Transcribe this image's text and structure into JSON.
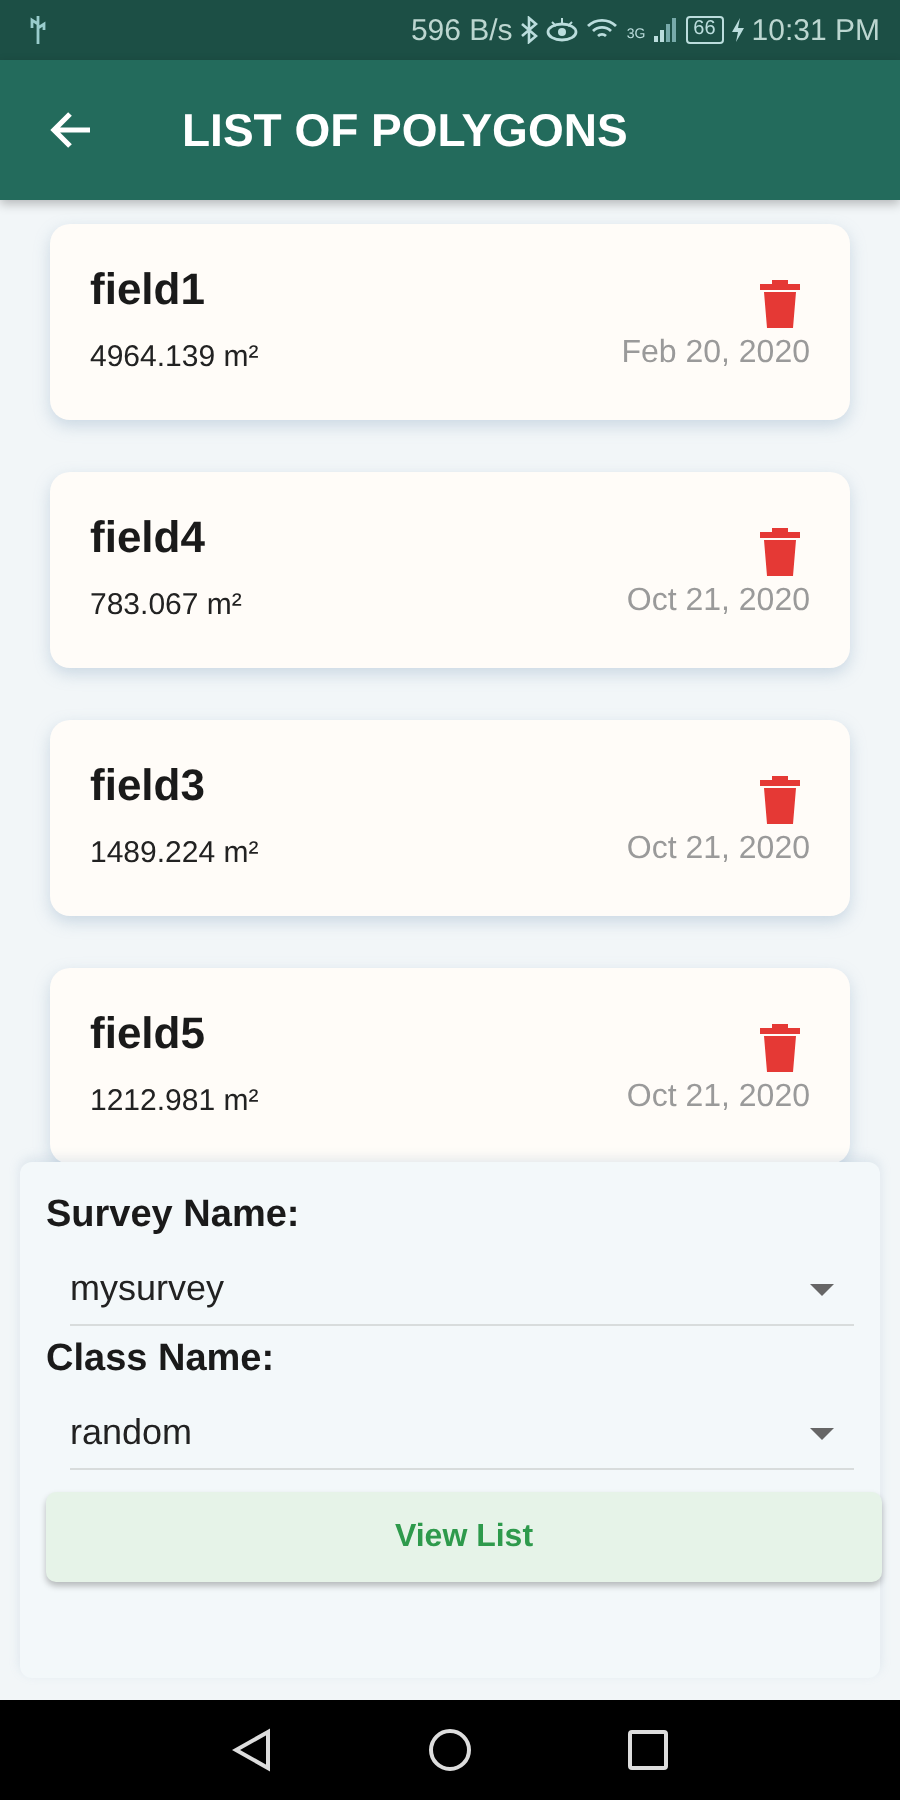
{
  "status_bar": {
    "speed": "596 B/s",
    "network": "3G",
    "battery": "66",
    "time": "10:31 PM"
  },
  "app_bar": {
    "title": "LIST OF POLYGONS"
  },
  "polygons": [
    {
      "name": "field1",
      "area": "4964.139 m²",
      "date": "Feb 20, 2020"
    },
    {
      "name": "field4",
      "area": "783.067 m²",
      "date": "Oct 21, 2020"
    },
    {
      "name": "field3",
      "area": "1489.224 m²",
      "date": "Oct 21, 2020"
    },
    {
      "name": "field5",
      "area": "1212.981 m²",
      "date": "Oct 21, 2020"
    }
  ],
  "filter_panel": {
    "fields": [
      {
        "label": "Survey Name:",
        "value": "mysurvey"
      },
      {
        "label": "Class Name:",
        "value": "random"
      }
    ],
    "button": "View List"
  }
}
